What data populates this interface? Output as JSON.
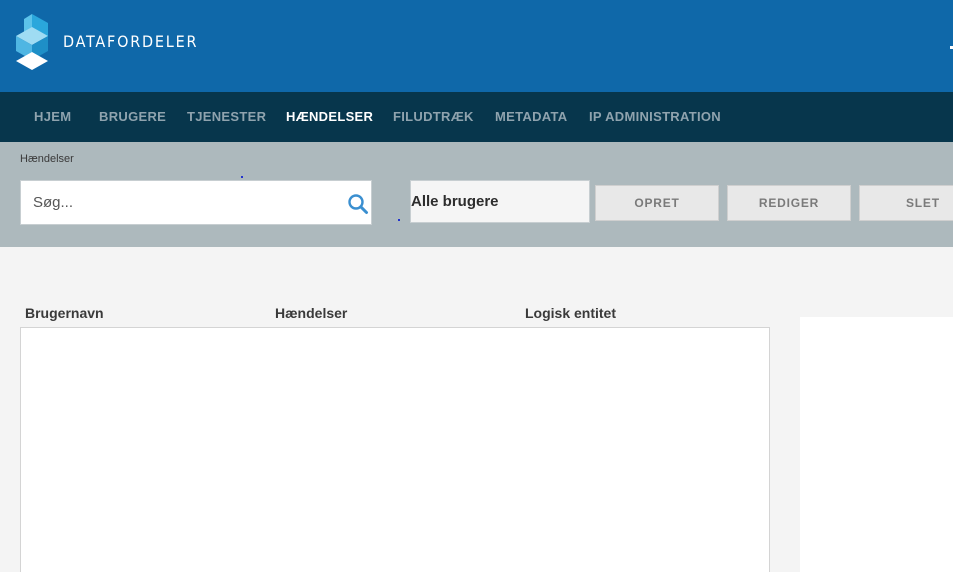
{
  "header": {
    "logo_text": "DATAFORDELER"
  },
  "nav": {
    "items": [
      {
        "label": "HJEM",
        "active": false
      },
      {
        "label": "BRUGERE",
        "active": false
      },
      {
        "label": "TJENESTER",
        "active": false
      },
      {
        "label": "HÆNDELSER",
        "active": true
      },
      {
        "label": "FILUDTRÆK",
        "active": false
      },
      {
        "label": "METADATA",
        "active": false
      },
      {
        "label": "IP ADMINISTRATION",
        "active": false
      }
    ]
  },
  "toolbar": {
    "breadcrumb": "Hændelser",
    "search_placeholder": "Søg...",
    "user_filter": "Alle brugere",
    "buttons": {
      "create": "OPRET",
      "edit": "REDIGER",
      "delete": "SLET"
    }
  },
  "table": {
    "columns": [
      "Brugernavn",
      "Hændelser",
      "Logisk entitet"
    ],
    "rows": []
  },
  "colors": {
    "header_bg": "#0f68a9",
    "nav_bg": "#07364c",
    "toolbar_bg": "#adb9bd",
    "accent_icon": "#3a8fd0"
  },
  "icons": {
    "search": "search-icon",
    "logo": "datafordeler-logo-icon"
  }
}
